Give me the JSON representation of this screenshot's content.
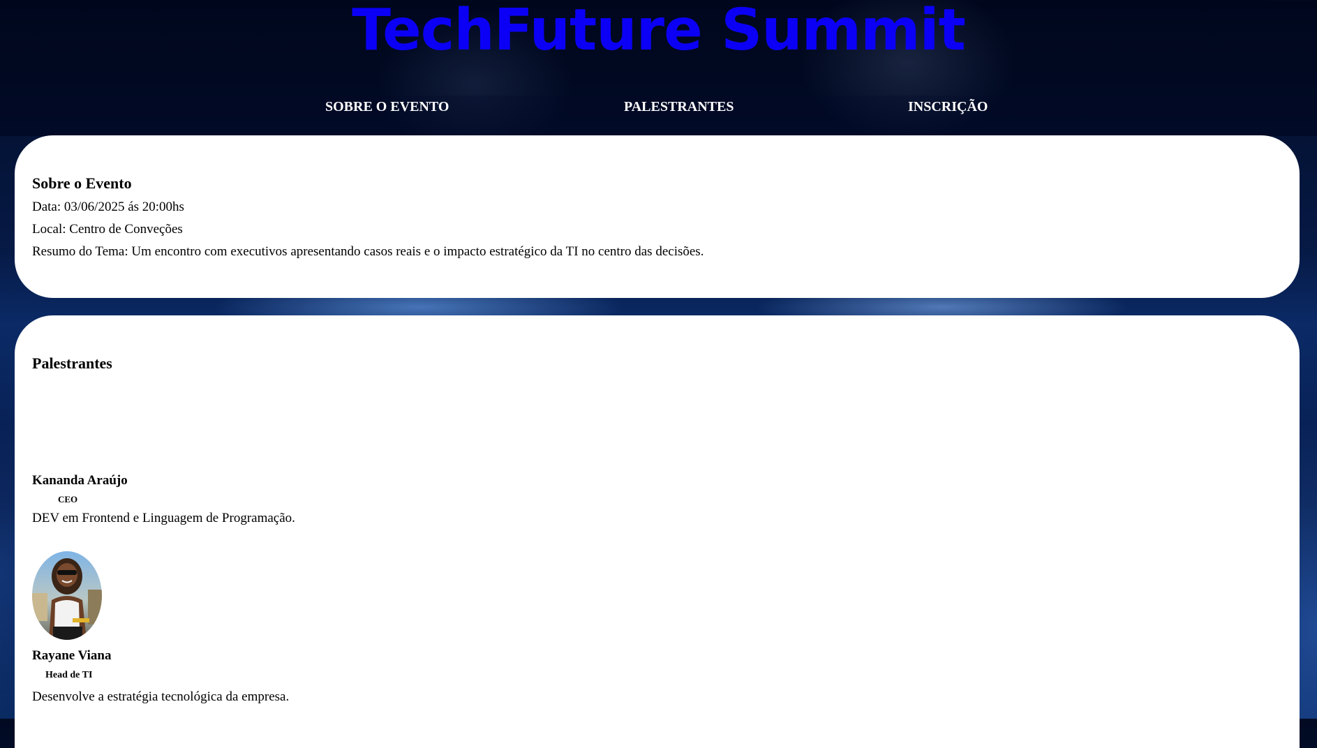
{
  "header": {
    "title": "TechFuture Summit"
  },
  "nav": {
    "items": [
      {
        "label": "SOBRE O EVENTO"
      },
      {
        "label": "PALESTRANTES"
      },
      {
        "label": "INSCRIÇÃO"
      }
    ]
  },
  "about": {
    "heading": "Sobre o Evento",
    "date": "Data: 03/06/2025 ás 20:00hs",
    "location": "Local: Centro de Conveções",
    "summary": "Resumo do Tema: Um encontro com executivos apresentando casos reais e o impacto estratégico da TI no centro das decisões."
  },
  "speakers": {
    "heading": "Palestrantes",
    "items": [
      {
        "name": "Kananda Araújo",
        "role": "CEO",
        "description": "DEV em Frontend e Linguagem de Programação."
      },
      {
        "name": "Rayane Viana",
        "role": "Head de TI",
        "description": "Desenvolve a estratégia tecnológica da empresa."
      }
    ]
  }
}
